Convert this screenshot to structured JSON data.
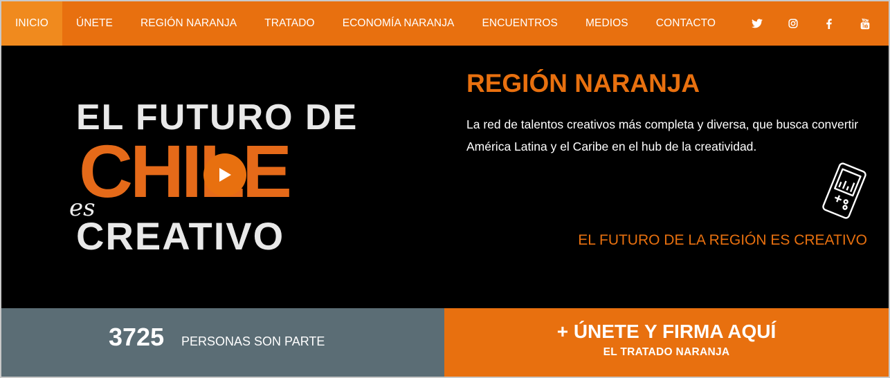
{
  "nav": {
    "items": [
      {
        "label": "INICIO",
        "active": true
      },
      {
        "label": "ÚNETE"
      },
      {
        "label": "REGIÓN NARANJA"
      },
      {
        "label": "TRATADO"
      },
      {
        "label": "ECONOMÍA NARANJA"
      },
      {
        "label": "ENCUENTROS"
      },
      {
        "label": "MEDIOS"
      },
      {
        "label": "CONTACTO"
      }
    ],
    "social": [
      "twitter-icon",
      "instagram-icon",
      "facebook-icon",
      "youtube-icon"
    ]
  },
  "video": {
    "line1": "EL FUTURO DE",
    "line2": "CHILE",
    "es": "es",
    "line3": "CREATIVO",
    "play_icon": "play-icon"
  },
  "info": {
    "title": "REGIÓN NARANJA",
    "description": "La red de talentos creativos más completa y diversa, que busca convertir América Latina y el Caribe en el hub de la creatividad.",
    "icon": "gamepad-icon",
    "tagline": "EL FUTURO DE LA REGIÓN ES CREATIVO"
  },
  "counter": {
    "number": "3725",
    "label": "PERSONAS SON PARTE"
  },
  "cta": {
    "main": "+ ÚNETE Y FIRMA AQUÍ",
    "sub": "EL TRATADO NARANJA"
  },
  "colors": {
    "accent": "#e8700f",
    "nav_active": "#f08a1e",
    "counter_bg": "#5b6d75",
    "hero_bg": "#000000"
  }
}
